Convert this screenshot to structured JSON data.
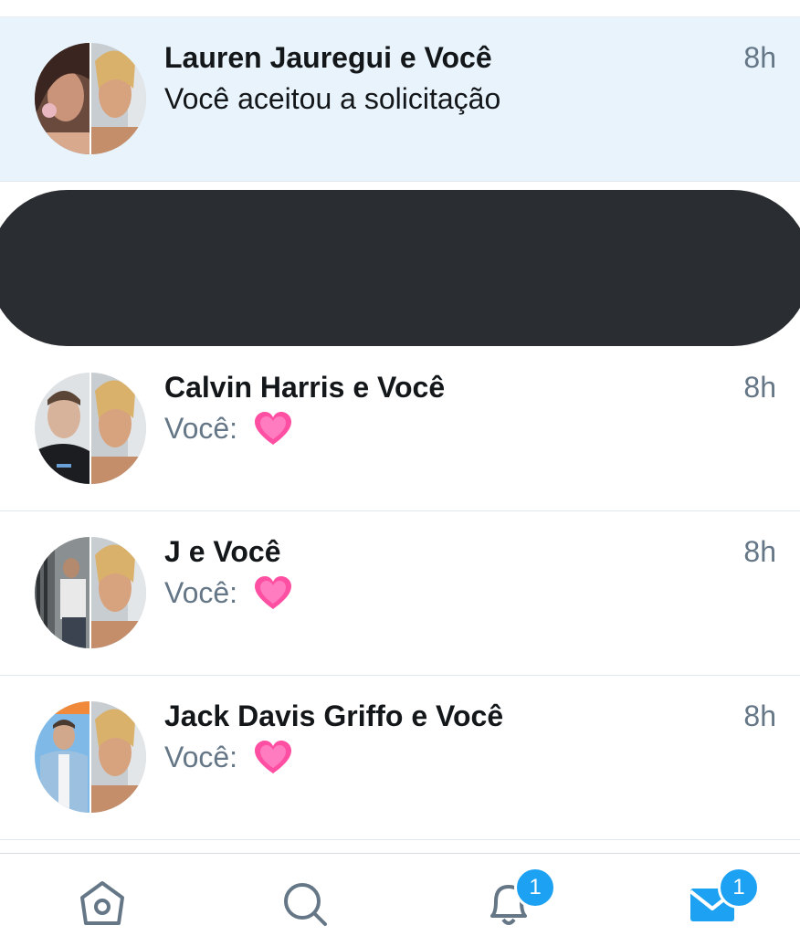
{
  "conversations": [
    {
      "name": "Lauren Jauregui e Você",
      "preview": "Você aceitou a solicitação",
      "time": "8h",
      "highlighted": true
    },
    {
      "name": "Calvin Harris e Você",
      "preview": "Você:",
      "emoji": "heart-icon",
      "time": "8h"
    },
    {
      "name": "J e Você",
      "preview": "Você:",
      "emoji": "heart-icon",
      "time": "8h"
    },
    {
      "name": "Jack Davis Griffo e Você",
      "preview": "Você:",
      "emoji": "heart-icon",
      "time": "8h"
    }
  ],
  "tabbar": {
    "notifications_badge": "1",
    "messages_badge": "1"
  },
  "colors": {
    "accent": "#1da1f2",
    "highlight_row": "#e8f3fc",
    "heart": "#ff4fa3"
  }
}
